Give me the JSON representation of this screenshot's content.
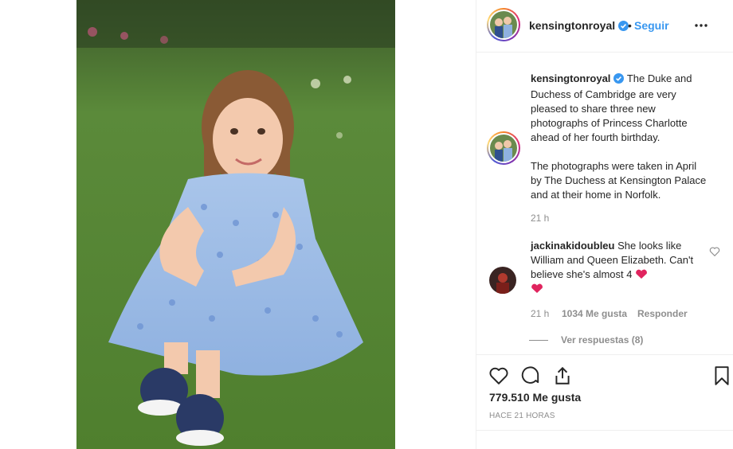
{
  "post": {
    "username": "kensingtonroyal",
    "follow_label": "Seguir",
    "separator": "•",
    "verified": true
  },
  "caption": {
    "username": "kensingtonroyal",
    "paragraph1": "The Duke and Duchess of Cambridge are very pleased to share three new photographs of Princess Charlotte ahead of her fourth birthday.",
    "paragraph2": "The photographs were taken in April by The Duchess at Kensington Palace and at their home in Norfolk.",
    "time": "21 h"
  },
  "comment": {
    "username": "jackinakidoubleu",
    "text": "She looks like William and Queen Elizabeth. Can't believe she's almost 4",
    "time": "21 h",
    "likes": "1034 Me gusta",
    "reply_label": "Responder",
    "view_replies": "Ver respuestas (8)"
  },
  "footer": {
    "likes_count": "779.510 Me gusta",
    "timestamp": "HACE 21 HORAS"
  },
  "icons": {
    "verified": "verified-badge-icon",
    "more": "more-options-icon",
    "like": "heart-icon",
    "comment": "comment-icon",
    "share": "share-icon",
    "save": "bookmark-icon"
  },
  "colors": {
    "link": "#3897f0",
    "verified": "#3897f0",
    "heart_emoji": "#e0245e",
    "muted": "#8e8e8e"
  }
}
